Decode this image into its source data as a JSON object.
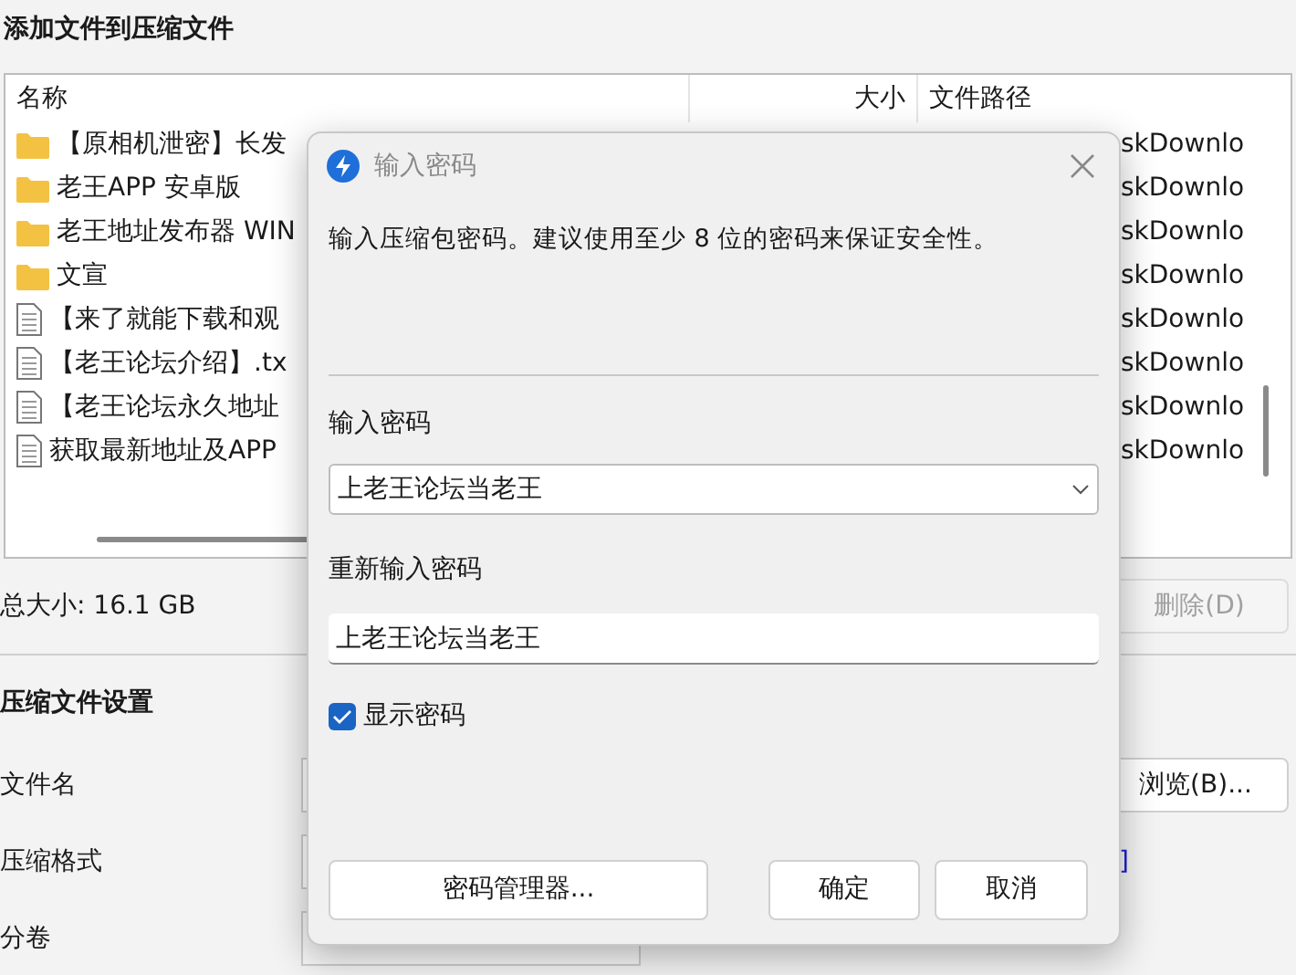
{
  "window": {
    "title": "添加文件到压缩文件"
  },
  "file_list": {
    "columns": [
      "名称",
      "大小",
      "文件路径"
    ],
    "rows": [
      {
        "kind": "folder",
        "name": "【原相机泄密】长发",
        "path": "skDownlo"
      },
      {
        "kind": "folder",
        "name": "老王APP 安卓版",
        "path": "skDownlo"
      },
      {
        "kind": "folder",
        "name": "老王地址发布器 WIN",
        "path": "skDownlo"
      },
      {
        "kind": "folder",
        "name": "文宣",
        "path": "skDownlo"
      },
      {
        "kind": "file",
        "name": "【来了就能下载和观",
        "path": "skDownlo"
      },
      {
        "kind": "file",
        "name": "【老王论坛介绍】.tx",
        "path": "skDownlo"
      },
      {
        "kind": "file",
        "name": "【老王论坛永久地址",
        "path": "skDownlo"
      },
      {
        "kind": "file",
        "name": "获取最新地址及APP",
        "path": "skDownlo"
      }
    ]
  },
  "total_size": "总大小: 16.1 GB",
  "delete_button": {
    "label": "删除(D)",
    "disabled": true
  },
  "settings": {
    "title": "压缩文件设置",
    "filename_label": "文件名",
    "browse_button": "浏览(B)...",
    "format_label": "压缩格式",
    "format_link": "]",
    "split_label": "分卷"
  },
  "dialog": {
    "title": "输入密码",
    "description": "输入压缩包密码。建议使用至少 8 位的密码来保证安全性。",
    "password_label": "输入密码",
    "password_value": "上老王论坛当老王",
    "confirm_label": "重新输入密码",
    "confirm_value": "上老王论坛当老王",
    "show_password": {
      "label": "显示密码",
      "checked": true
    },
    "buttons": [
      "密码管理器...",
      "确定",
      "取消"
    ]
  }
}
